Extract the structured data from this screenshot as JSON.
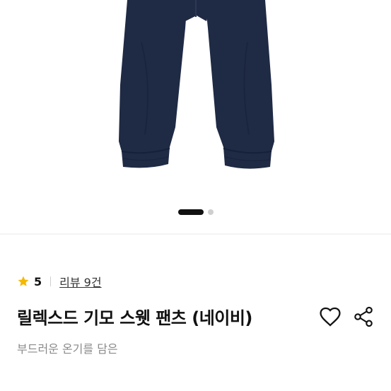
{
  "carousel": {
    "slide_count": 2,
    "active_index": 0
  },
  "rating": {
    "score": "5",
    "reviews_label": "리뷰 9건"
  },
  "product": {
    "title": "릴렉스드 기모 스웻 팬츠 (네이비)",
    "subtitle": "부드러운 온기를 담은"
  },
  "colors": {
    "pants": "#1f2a44",
    "star": "#f5b800",
    "accent": "#111111"
  },
  "icons": {
    "star": "star-icon",
    "heart": "heart-icon",
    "share": "share-icon"
  }
}
